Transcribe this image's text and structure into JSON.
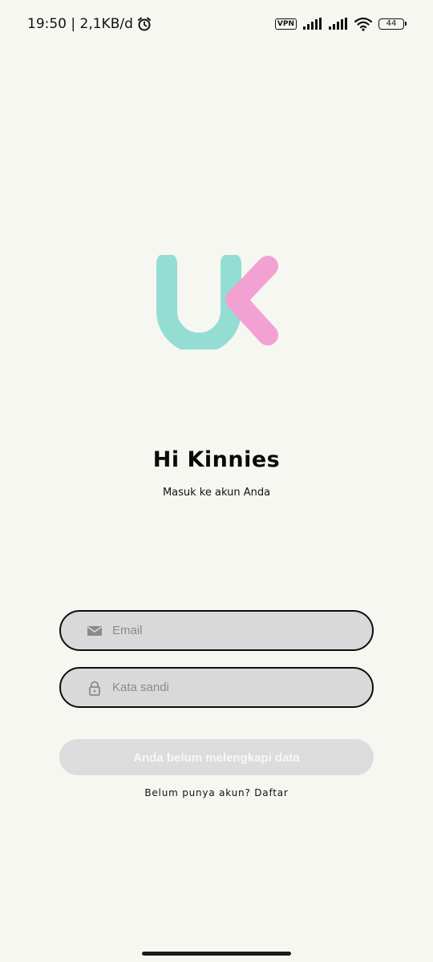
{
  "status_bar": {
    "time_speed": "19:50 | 2,1KB/d",
    "vpn": "VPN",
    "battery": "44"
  },
  "logo": {
    "letter_u_color": "#93ddd3",
    "letter_k_color": "#f3a1d3"
  },
  "login": {
    "title": "Hi Kinnies",
    "subtitle": "Masuk ke akun Anda",
    "email_placeholder": "Email",
    "password_placeholder": "Kata sandi",
    "submit_label": "Anda belum melengkapi data",
    "register_prompt": "Belum punya akun?",
    "register_link": "Daftar"
  },
  "colors": {
    "background": "#f7f7f2",
    "field_fill": "#d9d9d9",
    "button_disabled": "#dcdcdc"
  },
  "icons": {
    "email_field": "envelope-icon",
    "password_field": "lock-icon"
  }
}
